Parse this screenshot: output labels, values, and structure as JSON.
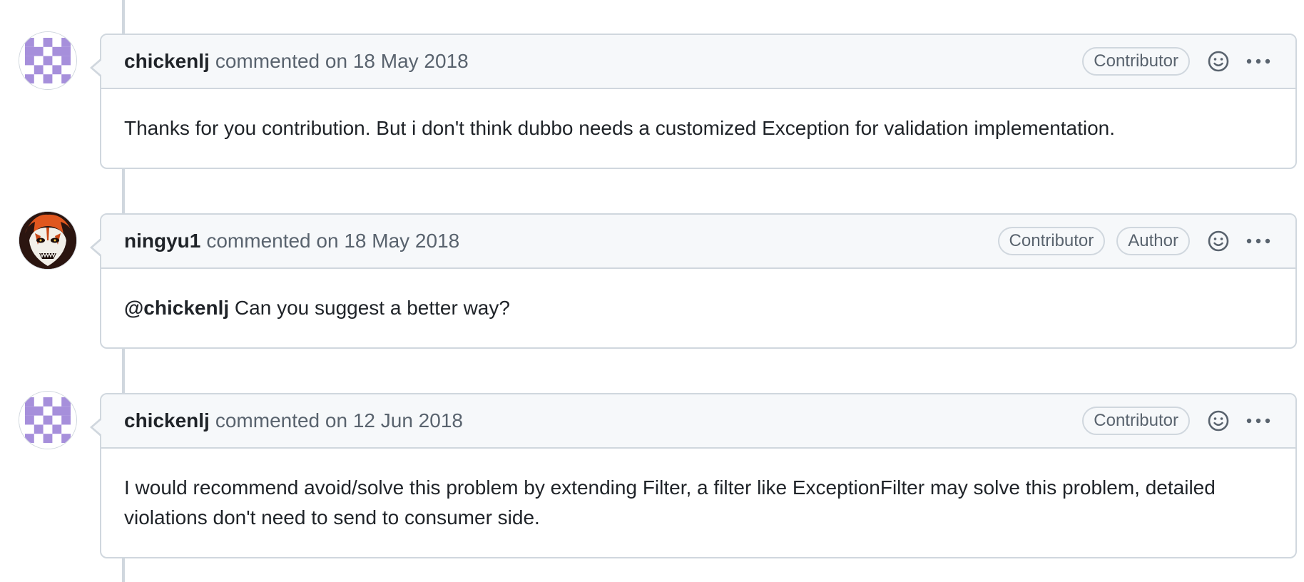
{
  "comments": [
    {
      "author": "chickenlj",
      "meta": "commented on 18 May 2018",
      "labels": [
        "Contributor"
      ],
      "avatar_icon": "identicon-purple",
      "mention": "",
      "body": "Thanks for you contribution. But i don't think dubbo needs a customized Exception for validation implementation."
    },
    {
      "author": "ningyu1",
      "meta": "commented on 18 May 2018",
      "labels": [
        "Contributor",
        "Author"
      ],
      "avatar_icon": "character-avatar",
      "mention": "@chickenlj",
      "body": "Can you suggest a better way?"
    },
    {
      "author": "chickenlj",
      "meta": "commented on 12 Jun 2018",
      "labels": [
        "Contributor"
      ],
      "avatar_icon": "identicon-purple",
      "mention": "",
      "body": "I would recommend avoid/solve this problem by extending Filter, a filter like ExceptionFilter may solve this problem, detailed violations don't need to send to consumer side."
    }
  ],
  "icons": {
    "reaction": "smiley-icon",
    "more": "kebab-horizontal-icon"
  },
  "colors": {
    "identicon": "#a68fdb",
    "timeline": "#d0d7de",
    "header_bg": "#f6f8fa",
    "muted_text": "#59636e"
  }
}
